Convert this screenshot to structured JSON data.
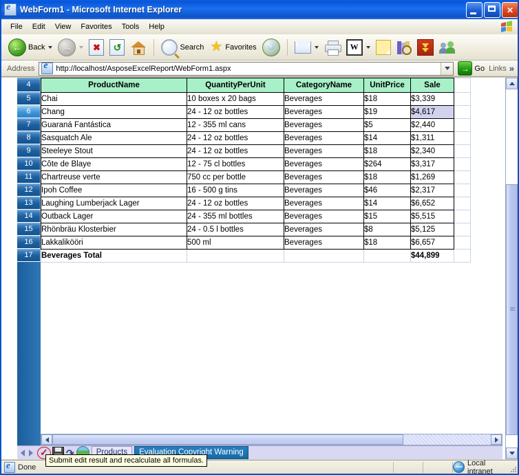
{
  "window": {
    "title": "WebForm1 - Microsoft Internet Explorer",
    "icon": "ie-document-icon",
    "minimize_label": "Minimize",
    "maximize_label": "Maximize",
    "close_label": "Close"
  },
  "menu": {
    "items": [
      "File",
      "Edit",
      "View",
      "Favorites",
      "Tools",
      "Help"
    ]
  },
  "toolbar": {
    "back_label": "Back",
    "search_label": "Search",
    "favorites_label": "Favorites",
    "word_glyph": "W"
  },
  "address": {
    "label": "Address",
    "url": "http://localhost/AsposeExcelReport/WebForm1.aspx",
    "go_label": "Go",
    "go_glyph": "→",
    "links_label": "Links",
    "chevron": "»"
  },
  "sheet": {
    "row_numbers": [
      "4",
      "5",
      "6",
      "7",
      "8",
      "9",
      "10",
      "11",
      "12",
      "13",
      "14",
      "15",
      "16",
      "17"
    ],
    "selected_row": "6",
    "selected_cell_value": "$4,617",
    "headers": [
      "ProductName",
      "QuantityPerUnit",
      "CategoryName",
      "UnitPrice",
      "Sale"
    ],
    "rows": [
      [
        "Chai",
        "10 boxes x 20 bags",
        "Beverages",
        "$18",
        "$3,339"
      ],
      [
        "Chang",
        "24 - 12 oz bottles",
        "Beverages",
        "$19",
        "$4,617"
      ],
      [
        "Guaraná Fantástica",
        "12 - 355 ml cans",
        "Beverages",
        "$5",
        "$2,440"
      ],
      [
        "Sasquatch Ale",
        "24 - 12 oz bottles",
        "Beverages",
        "$14",
        "$1,311"
      ],
      [
        "Steeleye Stout",
        "24 - 12 oz bottles",
        "Beverages",
        "$18",
        "$2,340"
      ],
      [
        "Côte de Blaye",
        "12 - 75 cl bottles",
        "Beverages",
        "$264",
        "$3,317"
      ],
      [
        "Chartreuse verte",
        "750 cc per bottle",
        "Beverages",
        "$18",
        "$1,269"
      ],
      [
        "Ipoh Coffee",
        "16 - 500 g tins",
        "Beverages",
        "$46",
        "$2,317"
      ],
      [
        "Laughing Lumberjack Lager",
        "24 - 12 oz bottles",
        "Beverages",
        "$14",
        "$6,652"
      ],
      [
        "Outback Lager",
        "24 - 355 ml bottles",
        "Beverages",
        "$15",
        "$5,515"
      ],
      [
        "Rhönbräu Klosterbier",
        "24 - 0.5 l bottles",
        "Beverages",
        "$8",
        "$5,125"
      ],
      [
        "Lakkalikööri",
        "500 ml",
        "Beverages",
        "$18",
        "$6,657"
      ]
    ],
    "total_row": {
      "label": "Beverages Total",
      "quantity": "",
      "category": "",
      "unit_price": "",
      "sale": "$44,899"
    },
    "header_fill": "#a8f0c8",
    "selection_fill": "#d3d2ee",
    "row_header_fill": "#1d5f9e"
  },
  "sheet_tabs": {
    "prev_label": "Previous sheet",
    "next_label": "Next sheet",
    "submit_icon": "red-check-circle-icon",
    "save_icon": "floppy-disk-icon",
    "undo_icon": "undo-arrow-icon",
    "globe_icon": "globe-icon",
    "tabs": [
      {
        "label": "Products",
        "active": false
      },
      {
        "label": "Evaluation Copyright Warning",
        "active": true
      }
    ]
  },
  "tooltip": {
    "text": "Submit edit result and recalculate all formulas."
  },
  "status": {
    "text": "Done",
    "zone": "Local intranet"
  }
}
